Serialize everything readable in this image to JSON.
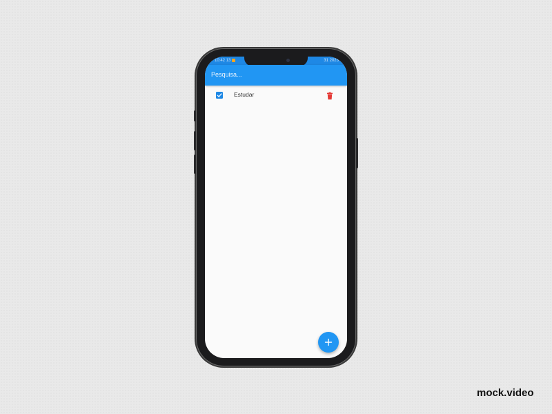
{
  "status_bar": {
    "time": "10:42 13",
    "right_text": "31 2023",
    "color": "#1e88e5"
  },
  "app_bar": {
    "search_placeholder": "Pesquisa...",
    "color": "#2196f3"
  },
  "tasks": [
    {
      "label": "Estudar",
      "checked": true
    }
  ],
  "colors": {
    "accent": "#2196f3",
    "delete": "#e53935"
  },
  "fab": {
    "icon": "plus-icon"
  },
  "watermark": "mock.video"
}
